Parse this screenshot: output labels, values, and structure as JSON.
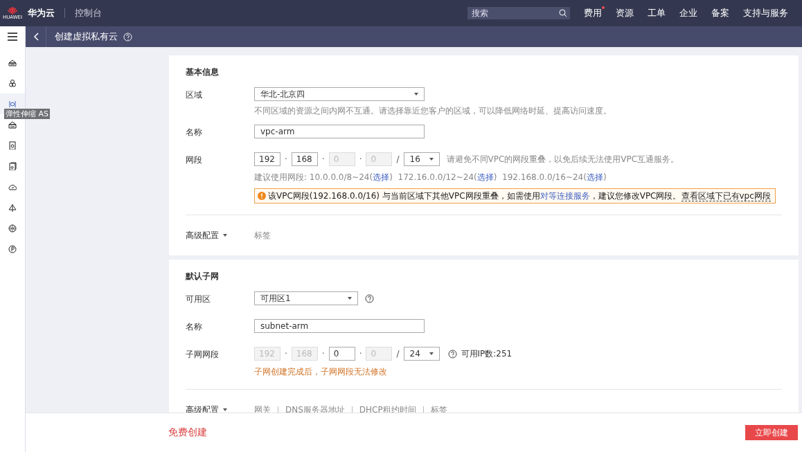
{
  "header": {
    "logo_text": "HUAWEI",
    "brand": "华为云",
    "console": "控制台",
    "search": {
      "placeholder": "搜索"
    },
    "nav": [
      {
        "label": "费用",
        "badge": true
      },
      {
        "label": "资源",
        "badge": false
      },
      {
        "label": "工单",
        "badge": false
      },
      {
        "label": "企业",
        "badge": false
      },
      {
        "label": "备案",
        "badge": false
      },
      {
        "label": "支持与服务",
        "badge": false
      }
    ]
  },
  "subheader": {
    "title": "创建虚拟私有云"
  },
  "sidebar": {
    "tooltip": "弹性伸缩 AS",
    "items": [
      {
        "kind": "cloud-server",
        "selected": false
      },
      {
        "kind": "cluster",
        "selected": false
      },
      {
        "kind": "scaling",
        "selected": true
      },
      {
        "kind": "host",
        "selected": false
      },
      {
        "kind": "disk",
        "selected": false
      },
      {
        "kind": "backup",
        "selected": false
      },
      {
        "kind": "cloud",
        "selected": false
      },
      {
        "kind": "balance",
        "selected": false
      },
      {
        "kind": "globe",
        "selected": false
      },
      {
        "kind": "parking",
        "selected": false
      }
    ]
  },
  "basic": {
    "title": "基本信息",
    "region": {
      "label": "区域",
      "value": "华北-北京四",
      "hint": "不同区域的资源之间内网不互通。请选择靠近您客户的区域，可以降低网络时延、提高访问速度。"
    },
    "name": {
      "label": "名称",
      "value": "vpc-arm"
    },
    "cidr": {
      "label": "网段",
      "separator": "·",
      "mask_separator": "/",
      "mask": "16",
      "octets": [
        {
          "value": "192",
          "disabled": false
        },
        {
          "value": "168",
          "disabled": false
        },
        {
          "value": "0",
          "disabled": true
        },
        {
          "value": "0",
          "disabled": true
        }
      ],
      "hint": "请避免不同VPC的网段重叠，以免后续无法使用VPC互通服务。",
      "suggest_prefix": "建议使用网段: ",
      "suggestions": [
        {
          "range": "10.0.0.0/8~24(",
          "link": "选择",
          "close": ")"
        },
        {
          "range": "172.16.0.0/12~24(",
          "link": "选择",
          "close": ")"
        },
        {
          "range": "192.168.0.0/16~24(",
          "link": "选择",
          "close": ")"
        }
      ],
      "warning": {
        "before": "该VPC网段(192.168.0.0/16) 与当前区域下其他VPC网段重叠，如需使用",
        "link": "对等连接服务",
        "after": "，建议您修改VPC网段。",
        "link2": "查看区域下已有vpc网段"
      }
    },
    "advanced": {
      "label": "高级配置",
      "tags": [
        "标签"
      ]
    }
  },
  "subnet": {
    "title": "默认子网",
    "az": {
      "label": "可用区",
      "value": "可用区1",
      "help": true
    },
    "name": {
      "label": "名称",
      "value": "subnet-arm"
    },
    "cidr": {
      "label": "子网网段",
      "separator": "·",
      "mask_separator": "/",
      "mask": "24",
      "help": true,
      "octets": [
        {
          "value": "192",
          "disabled": true
        },
        {
          "value": "168",
          "disabled": true
        },
        {
          "value": "0",
          "disabled": false
        },
        {
          "value": "0",
          "disabled": true
        }
      ],
      "available": "可用IP数:251",
      "note": "子网创建完成后，子网网段无法修改"
    },
    "advanced": {
      "label": "高级配置",
      "tags": [
        "网关",
        "DNS服务器地址",
        "DHCP租约时间",
        "标签"
      ]
    }
  },
  "footer": {
    "free_text": "免费创建",
    "button": "立即创建"
  }
}
